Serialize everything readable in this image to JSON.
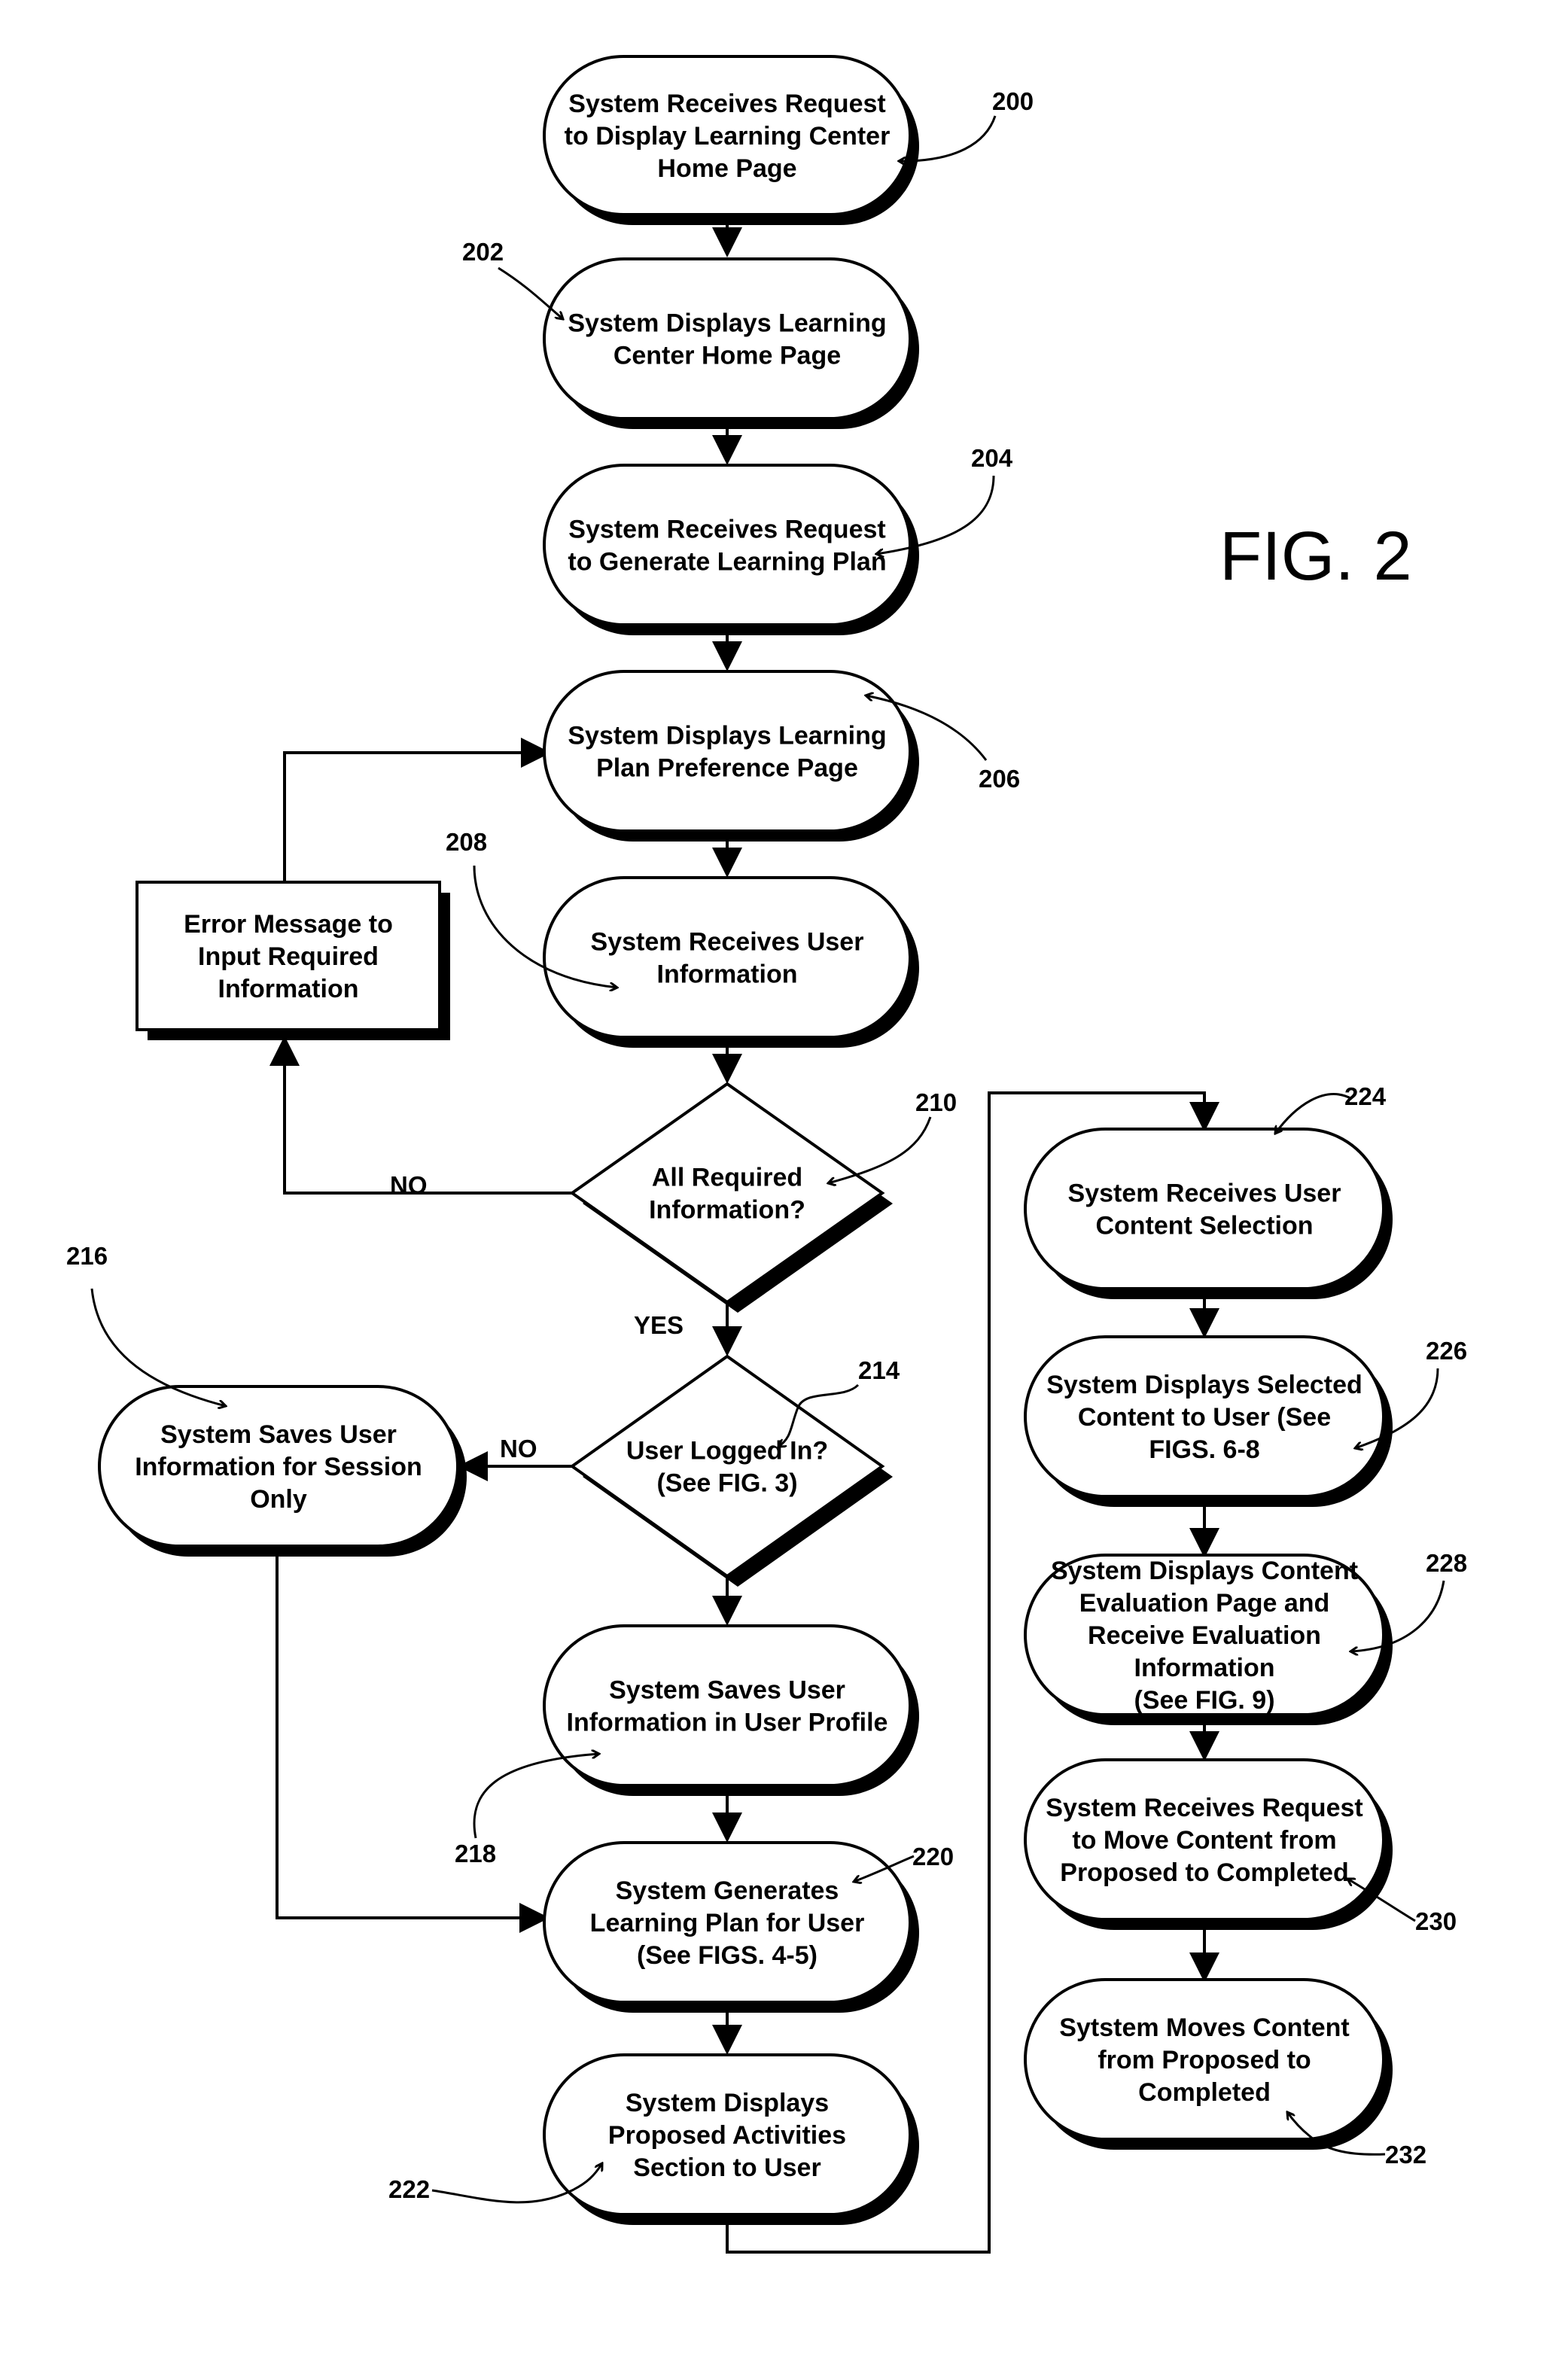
{
  "figure_label": "FIG. 2",
  "nodes": [
    {
      "id": "200",
      "shape": "terminal",
      "lines": [
        "System Receives Request",
        "to Display Learning Center",
        "Home Page"
      ]
    },
    {
      "id": "202",
      "shape": "terminal",
      "lines": [
        "System Displays Learning",
        "Center Home Page"
      ]
    },
    {
      "id": "204",
      "shape": "terminal",
      "lines": [
        "System Receives Request",
        "to Generate Learning Plan"
      ]
    },
    {
      "id": "206",
      "shape": "terminal",
      "lines": [
        "System Displays Learning",
        "Plan Preference Page"
      ]
    },
    {
      "id": "208",
      "shape": "terminal",
      "lines": [
        "System Receives User",
        "Information"
      ]
    },
    {
      "id": "error",
      "shape": "rect",
      "lines": [
        "Error Message to",
        "Input Required",
        "Information"
      ]
    },
    {
      "id": "210",
      "shape": "decision",
      "lines": [
        "All Required",
        "Information?"
      ]
    },
    {
      "id": "214",
      "shape": "decision",
      "lines": [
        "User Logged In?",
        "(See FIG. 3)"
      ]
    },
    {
      "id": "216",
      "shape": "terminal",
      "lines": [
        "System Saves User",
        "Information for Session",
        "Only"
      ]
    },
    {
      "id": "218",
      "shape": "terminal",
      "lines": [
        "System Saves User",
        "Information in User Profile"
      ]
    },
    {
      "id": "220",
      "shape": "terminal",
      "lines": [
        "System Generates",
        "Learning Plan for User",
        "(See FIGS. 4-5)"
      ]
    },
    {
      "id": "222",
      "shape": "terminal",
      "lines": [
        "System Displays",
        "Proposed Activities",
        "Section to User"
      ]
    },
    {
      "id": "224",
      "shape": "terminal",
      "lines": [
        "System Receives User",
        "Content Selection"
      ]
    },
    {
      "id": "226",
      "shape": "terminal",
      "lines": [
        "System Displays Selected",
        "Content to User (See",
        "FIGS. 6-8"
      ]
    },
    {
      "id": "228",
      "shape": "terminal",
      "lines": [
        "System Displays Content",
        "Evaluation Page and",
        "Receive Evaluation",
        "Information",
        "(See FIG. 9)"
      ]
    },
    {
      "id": "230",
      "shape": "terminal",
      "lines": [
        "System Receives Request",
        "to Move Content from",
        "Proposed to Completed"
      ]
    },
    {
      "id": "232",
      "shape": "terminal",
      "lines": [
        "Sytstem Moves Content",
        "from Proposed to",
        "Completed"
      ]
    }
  ],
  "ref_labels": [
    "200",
    "202",
    "204",
    "206",
    "208",
    "210",
    "214",
    "216",
    "218",
    "220",
    "222",
    "224",
    "226",
    "228",
    "230",
    "232"
  ],
  "branch_labels": {
    "no_210": "NO",
    "yes_210": "YES",
    "no_214": "NO"
  }
}
